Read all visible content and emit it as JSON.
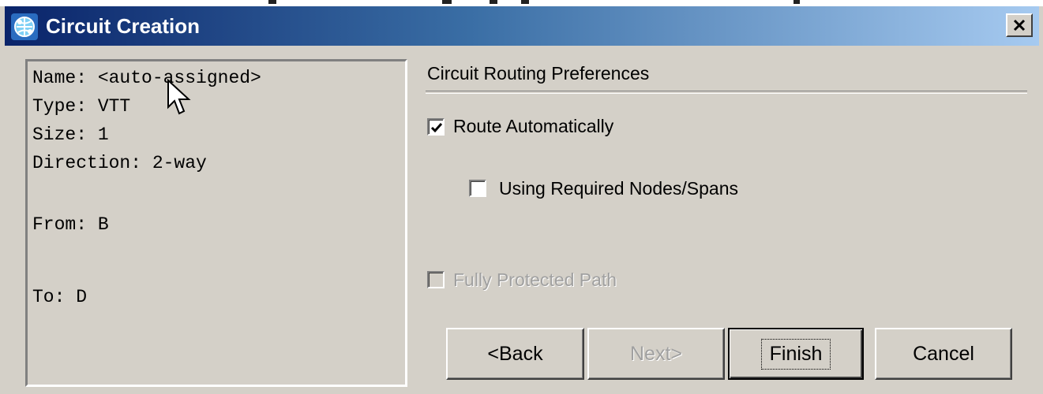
{
  "window": {
    "title": "Circuit Creation",
    "icon": "network-globe-icon",
    "close_label": "×"
  },
  "summary": {
    "name": "Name: <auto-assigned>",
    "type": "Type: VTT",
    "size": "Size: 1",
    "direction": "Direction: 2-way",
    "from": "From: B",
    "to": "To: D"
  },
  "routing": {
    "section_title": "Circuit Routing Preferences",
    "route_automatically": {
      "label": "Route Automatically",
      "checked": true,
      "enabled": true
    },
    "using_required_nodes": {
      "label": "Using Required Nodes/Spans",
      "checked": false,
      "enabled": true
    },
    "fully_protected_path": {
      "label": "Fully Protected Path",
      "checked": false,
      "enabled": false
    }
  },
  "buttons": {
    "back": "<Back",
    "next": "Next>",
    "finish": "Finish",
    "cancel": "Cancel"
  },
  "colors": {
    "titlebar_start": "#0a246a",
    "titlebar_end": "#a6caf0",
    "dialog_bg": "#d4d0c8"
  }
}
